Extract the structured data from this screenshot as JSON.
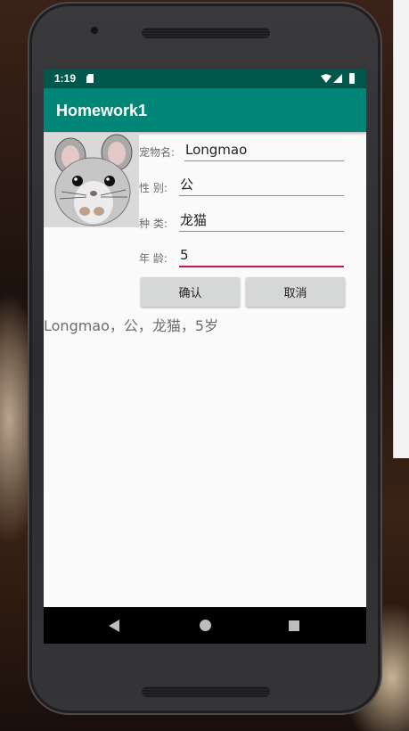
{
  "status_bar": {
    "time": "1:19"
  },
  "app_bar": {
    "title": "Homework1"
  },
  "form": {
    "name_label": "宠物名:",
    "name_value": "Longmao",
    "gender_label": "性  别:",
    "gender_value": "公",
    "species_label": "种  类:",
    "species_value": "龙猫",
    "age_label": "年  龄:",
    "age_value": "5"
  },
  "buttons": {
    "confirm_label": "确认",
    "cancel_label": "取消"
  },
  "result": {
    "text": "Longmao，公，龙猫，5岁"
  },
  "colors": {
    "status_bar": "#00574b",
    "app_bar": "#008577",
    "accent": "#c2185b"
  },
  "icons": [
    "sd-card-icon",
    "wifi-icon",
    "signal-icon",
    "battery-icon",
    "back-icon",
    "home-icon",
    "recents-icon"
  ]
}
